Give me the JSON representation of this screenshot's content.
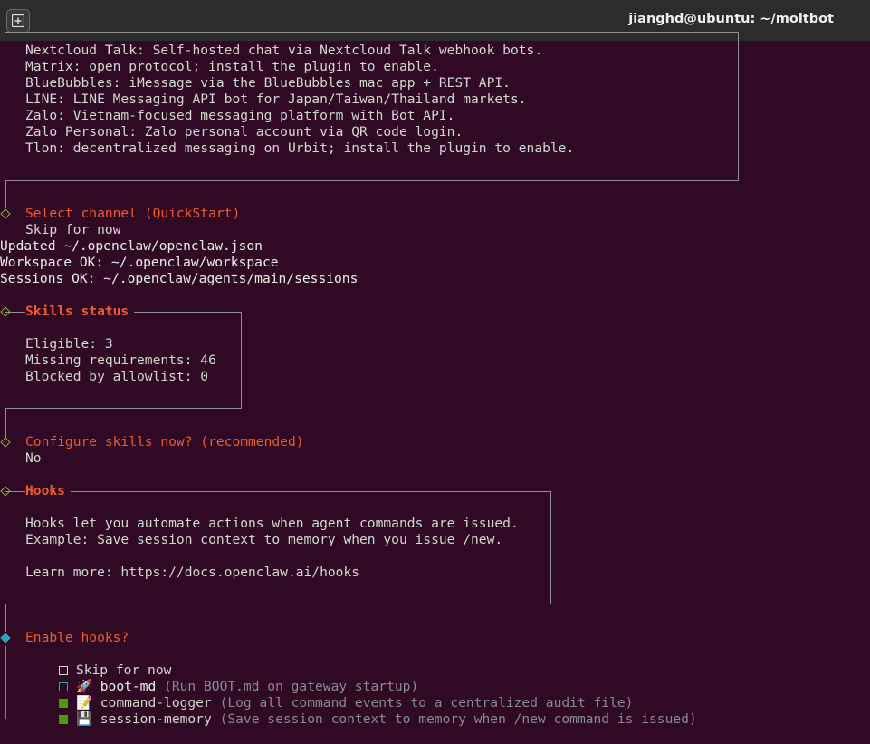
{
  "window": {
    "title": "jianghd@ubuntu: ~/moltbot"
  },
  "channels_list": [
    "Nextcloud Talk: Self-hosted chat via Nextcloud Talk webhook bots.",
    "Matrix: open protocol; install the plugin to enable.",
    "BlueBubbles: iMessage via the BlueBubbles mac app + REST API.",
    "LINE: LINE Messaging API bot for Japan/Taiwan/Thailand markets.",
    "Zalo: Vietnam-focused messaging platform with Bot API.",
    "Zalo Personal: Zalo personal account via QR code login.",
    "Tlon: decentralized messaging on Urbit; install the plugin to enable."
  ],
  "select_channel": {
    "title": "Select channel (QuickStart)",
    "answer": "Skip for now"
  },
  "output_lines": [
    "Updated ~/.openclaw/openclaw.json",
    "Workspace OK: ~/.openclaw/workspace",
    "Sessions OK: ~/.openclaw/agents/main/sessions"
  ],
  "skills_status": {
    "title": "Skills status",
    "lines": [
      "Eligible: 3",
      "Missing requirements: 46",
      "Blocked by allowlist: 0"
    ]
  },
  "configure_skills": {
    "title": "Configure skills now? (recommended)",
    "answer": "No"
  },
  "hooks": {
    "title": "Hooks",
    "line1": "Hooks let you automate actions when agent commands are issued.",
    "line2": "Example: Save session context to memory when you issue /new.",
    "line3": "Learn more: https://docs.openclaw.ai/hooks"
  },
  "enable_hooks": {
    "title": "Enable hooks?",
    "options": [
      {
        "icon": "",
        "name": "Skip for now",
        "desc": "",
        "checked": false
      },
      {
        "icon": "🚀",
        "name": "boot-md",
        "desc": "(Run BOOT.md on gateway startup)",
        "checked": false
      },
      {
        "icon": "📝",
        "name": "command-logger",
        "desc": "(Log all command events to a centralized audit file)",
        "checked": true
      },
      {
        "icon": "💾",
        "name": "session-memory",
        "desc": "(Save session context to memory when /new command is issued)",
        "checked": true
      }
    ]
  }
}
